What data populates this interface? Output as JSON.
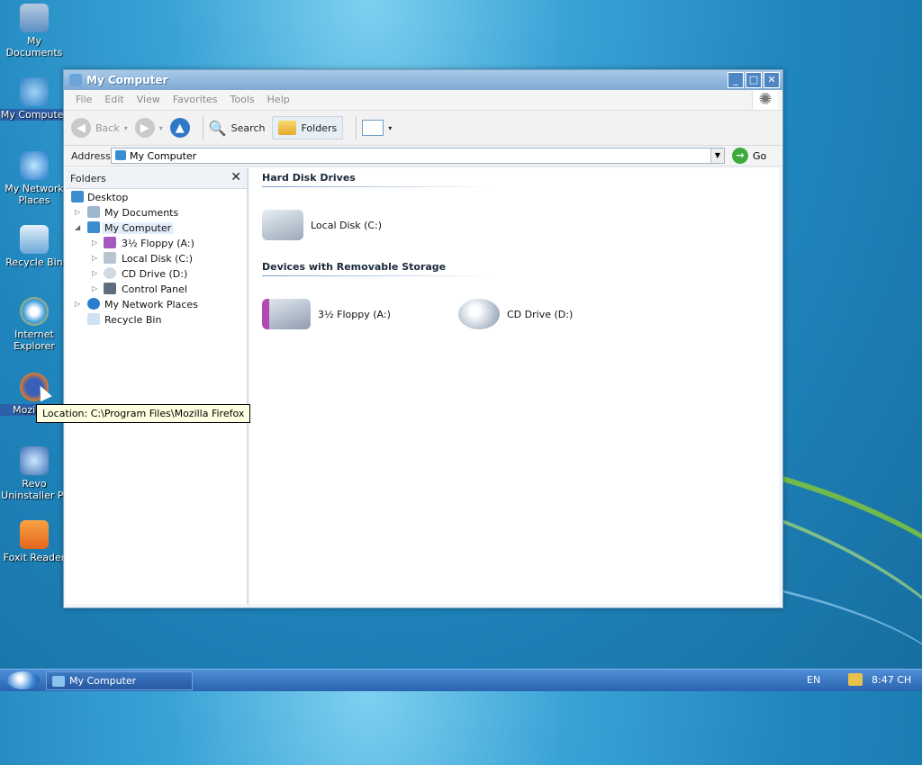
{
  "desktop": {
    "icons": [
      {
        "label": "My Documents"
      },
      {
        "label": "My Computer"
      },
      {
        "label": "My Network Places"
      },
      {
        "label": "Recycle Bin"
      },
      {
        "label": "Internet Explorer"
      },
      {
        "label": "Mozilla F"
      },
      {
        "label": "Revo Uninstaller Pr"
      },
      {
        "label": "Foxit Reader"
      }
    ],
    "tooltip": "Location: C:\\Program Files\\Mozilla Firefox"
  },
  "window": {
    "title": "My Computer",
    "controls": {
      "minimize": "_",
      "maximize": "□",
      "close": "✕"
    },
    "menu": [
      "File",
      "Edit",
      "View",
      "Favorites",
      "Tools",
      "Help"
    ],
    "toolbar": {
      "back": "Back",
      "search": "Search",
      "folders": "Folders"
    },
    "address": {
      "label": "Address",
      "value": "My Computer",
      "go": "Go"
    },
    "folders_panel": {
      "title": "Folders",
      "close": "✕",
      "tree": [
        {
          "label": "Desktop"
        },
        {
          "label": "My Documents"
        },
        {
          "label": "My Computer"
        },
        {
          "label": "3½ Floppy (A:)"
        },
        {
          "label": "Local Disk (C:)"
        },
        {
          "label": "CD Drive (D:)"
        },
        {
          "label": "Control Panel"
        },
        {
          "label": "My Network Places"
        },
        {
          "label": "Recycle Bin"
        }
      ]
    },
    "content": {
      "sections": [
        {
          "title": "Hard Disk Drives",
          "items": [
            {
              "label": "Local Disk (C:)"
            }
          ]
        },
        {
          "title": "Devices with Removable Storage",
          "items": [
            {
              "label": "3½ Floppy (A:)"
            },
            {
              "label": "CD Drive (D:)"
            }
          ]
        }
      ]
    }
  },
  "taskbar": {
    "task": "My Computer",
    "lang": "EN",
    "time": "8:47 CH"
  },
  "colors": {
    "accent": "#2a63b0",
    "selection": "#2d5fa8"
  }
}
